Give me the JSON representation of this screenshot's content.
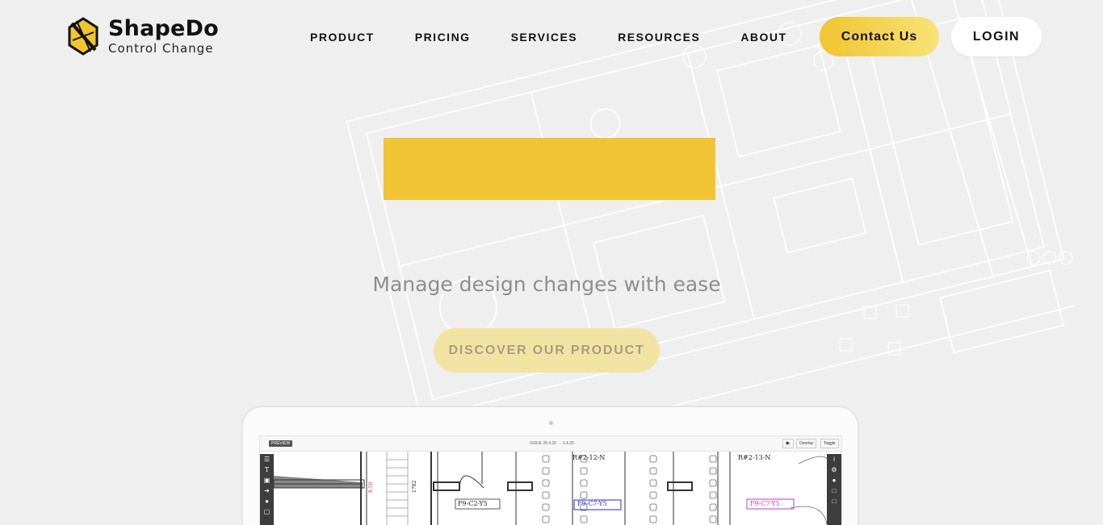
{
  "brand": {
    "name": "ShapeDo",
    "tagline": "Control Change"
  },
  "nav": {
    "items": [
      {
        "label": "PRODUCT"
      },
      {
        "label": "PRICING"
      },
      {
        "label": "SERVICES"
      },
      {
        "label": "RESOURCES"
      },
      {
        "label": "ABOUT"
      }
    ],
    "contact_label": "Contact Us",
    "login_label": "LOGIN"
  },
  "hero": {
    "subtitle": "Manage design changes with ease",
    "cta_label": "DISCOVER OUR PRODUCT"
  },
  "app_preview": {
    "badge": "PREVIEW",
    "file_name": "ISSUE 28.4.20 → 3.4.20",
    "play_icon": "▶",
    "overlay_label": "Overlay",
    "toggle_label": "Toggle",
    "room_tags": [
      "R#2-12-N",
      "R#2-13-N"
    ],
    "grid_tags": [
      "F9-C2-Y5",
      "F9-C7-Y5",
      "F9-C7-Y5"
    ],
    "dimension": "1782",
    "dimension_red": "8.50"
  },
  "colors": {
    "background": "#efefef",
    "accent_yellow": "#f0c434",
    "contact_gradient_start": "#f0c52f",
    "contact_gradient_end": "#f8e277",
    "cta_faded": "#f3e3a3",
    "subtitle_gray": "#8e8e8e"
  }
}
